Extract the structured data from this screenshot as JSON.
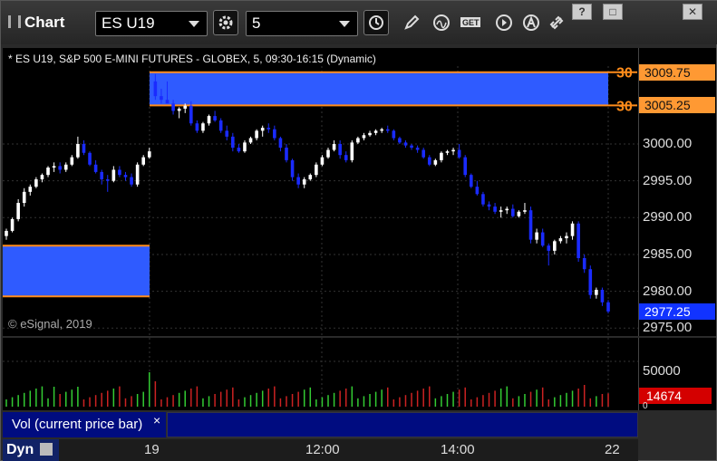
{
  "app": {
    "title": "Chart"
  },
  "toolbar": {
    "symbol": "ES U19",
    "interval": "5",
    "win_help": "?",
    "win_restore": "□",
    "win_close": "✕"
  },
  "chart": {
    "header": "* ES U19, S&P 500 E-MINI FUTURES - GLOBEX, 5, 09:30-16:15 (Dynamic)",
    "copyright": "© eSignal, 2019",
    "zone_label_1": "30",
    "zone_label_2": "30",
    "price_ticks": [
      "3000.00",
      "2995.00",
      "2990.00",
      "2985.00",
      "2980.00",
      "2975.00"
    ],
    "upper_zone_high": "3009.75",
    "upper_zone_low": "3005.25",
    "current_price": "2977.25",
    "colors": {
      "zone_fill": "#2f5bff",
      "zone_edge": "#ff8c1a",
      "up": "#ffffff",
      "down": "#1a2bff",
      "current": "#1133ff"
    }
  },
  "volume": {
    "label": "Vol (current price bar)",
    "close_glyph": "×",
    "tick": "50000",
    "current_value": "14674",
    "zero": "0"
  },
  "time_axis": {
    "labels": [
      "19",
      "12:00",
      "14:00",
      "22"
    ]
  },
  "footer": {
    "dyn_label": "Dyn"
  },
  "chart_data": {
    "type": "candlestick",
    "ylim": [
      2975,
      3011
    ],
    "candles": [
      [
        2987.5,
        2988.5,
        2987,
        2988.2
      ],
      [
        2988.2,
        2990,
        2988,
        2989.8
      ],
      [
        2989.8,
        2992.5,
        2989.5,
        2992
      ],
      [
        2992,
        2994,
        2991.5,
        2993.5
      ],
      [
        2993.5,
        2994.5,
        2993,
        2994.2
      ],
      [
        2994.2,
        2995.5,
        2994,
        2995.2
      ],
      [
        2995.2,
        2996,
        2994.8,
        2995.8
      ],
      [
        2995.8,
        2997,
        2995.5,
        2996.8
      ],
      [
        2996.8,
        2997.5,
        2996.2,
        2997
      ],
      [
        2997,
        2997.5,
        2996,
        2996.5
      ],
      [
        2996.5,
        2997.5,
        2996.2,
        2997.2
      ],
      [
        2997.2,
        2998.5,
        2997,
        2998.2
      ],
      [
        2998.2,
        3001,
        2998,
        3000
      ],
      [
        3000,
        3000.5,
        2998.5,
        2998.8
      ],
      [
        2998.8,
        2999,
        2997,
        2997.2
      ],
      [
        2997.2,
        2997.8,
        2996,
        2996.2
      ],
      [
        2996.2,
        2996.5,
        2994.5,
        2995.2
      ],
      [
        2995.2,
        2995.8,
        2993.5,
        2995
      ],
      [
        2995,
        2997,
        2994.8,
        2996.5
      ],
      [
        2996.5,
        2997,
        2995.5,
        2995.8
      ],
      [
        2995.8,
        2996.2,
        2995,
        2995.5
      ],
      [
        2995.5,
        2996,
        2994.2,
        2994.5
      ],
      [
        2994.5,
        2997.5,
        2994.2,
        2997.2
      ],
      [
        2997.2,
        2998.5,
        2997,
        2998.2
      ],
      [
        2998.2,
        2999.5,
        2998,
        2999
      ],
      [
        3008.5,
        3009.5,
        3006,
        3006.5
      ],
      [
        3006.5,
        3007.5,
        3005.5,
        3006
      ],
      [
        3006,
        3008.5,
        3005.8,
        3005.5
      ],
      [
        3005.5,
        3006,
        3004,
        3004.5
      ],
      [
        3004.5,
        3005,
        3003.5,
        3004.8
      ],
      [
        3004.8,
        3005.5,
        3004.2,
        3005.2
      ],
      [
        3005.2,
        3005.8,
        3002.5,
        3002.8
      ],
      [
        3002.8,
        3003.2,
        3001.5,
        3001.8
      ],
      [
        3001.8,
        3003,
        3001.5,
        3002.8
      ],
      [
        3002.8,
        3004,
        3002.5,
        3003.8
      ],
      [
        3003.8,
        3004.5,
        3003,
        3003.2
      ],
      [
        3003.2,
        3003.5,
        3001.5,
        3001.8
      ],
      [
        3001.8,
        3002.5,
        3000.5,
        3001
      ],
      [
        3001,
        3001.5,
        2999,
        2999.5
      ],
      [
        2999.5,
        3000,
        2998.8,
        2999
      ],
      [
        2999,
        3000.5,
        2998.8,
        3000.2
      ],
      [
        3000.2,
        3001,
        3000,
        3000.8
      ],
      [
        3000.8,
        3002,
        3000.5,
        3001.8
      ],
      [
        3001.8,
        3002.5,
        3001,
        3002.2
      ],
      [
        3002.2,
        3002.8,
        3001.5,
        3002
      ],
      [
        3002,
        3002.5,
        3000.5,
        3000.8
      ],
      [
        3000.8,
        3001,
        2999,
        2999.5
      ],
      [
        2999.5,
        3000,
        2997.5,
        2997.8
      ],
      [
        2997.8,
        2998,
        2995,
        2995.5
      ],
      [
        2995.5,
        2996,
        2994,
        2994.5
      ],
      [
        2994.5,
        2995.5,
        2994,
        2995.2
      ],
      [
        2995.2,
        2996,
        2995,
        2995.8
      ],
      [
        2995.8,
        2997.5,
        2995.5,
        2997.2
      ],
      [
        2997.2,
        2998.5,
        2997,
        2998.2
      ],
      [
        2998.2,
        2999.5,
        2998,
        2999.2
      ],
      [
        2999.2,
        3000.5,
        2999,
        3000
      ],
      [
        3000,
        3000.5,
        2998,
        2998.5
      ],
      [
        2998.5,
        2999,
        2997.5,
        2997.8
      ],
      [
        2997.8,
        3000.5,
        2997.5,
        3000.2
      ],
      [
        3000.2,
        3001,
        3000,
        3000.8
      ],
      [
        3000.8,
        3001.5,
        3000.5,
        3001.2
      ],
      [
        3001.2,
        3001.8,
        3001,
        3001.5
      ],
      [
        3001.5,
        3002,
        3001.2,
        3001.8
      ],
      [
        3001.8,
        3002.2,
        3001.5,
        3002
      ],
      [
        3002,
        3002.5,
        3001.5,
        3001.8
      ],
      [
        3001.8,
        3002,
        3000.5,
        3000.8
      ],
      [
        3000.8,
        3001,
        3000,
        3000.2
      ],
      [
        3000.2,
        3000.5,
        2999.5,
        2999.8
      ],
      [
        2999.8,
        3000,
        2999.2,
        2999.5
      ],
      [
        2999.5,
        2999.8,
        2998.8,
        2999.2
      ],
      [
        2999.2,
        2999.5,
        2998,
        2998.2
      ],
      [
        2998.2,
        2998.5,
        2997,
        2997.2
      ],
      [
        2997.2,
        2998,
        2997,
        2997.8
      ],
      [
        2997.8,
        2999,
        2997.5,
        2998.8
      ],
      [
        2998.8,
        2999.2,
        2998.5,
        2999
      ],
      [
        2999,
        2999.5,
        2998.5,
        2999.2
      ],
      [
        2999.2,
        3000,
        2998,
        2998.2
      ],
      [
        2998.2,
        2998.5,
        2995.5,
        2995.8
      ],
      [
        2995.8,
        2996,
        2994,
        2994.2
      ],
      [
        2994.2,
        2995,
        2993,
        2993.2
      ],
      [
        2993.2,
        2993.5,
        2991.5,
        2991.8
      ],
      [
        2991.8,
        2992.2,
        2991,
        2991.5
      ],
      [
        2991.5,
        2992,
        2990.5,
        2990.8
      ],
      [
        2990.8,
        2991.5,
        2990,
        2991
      ],
      [
        2991,
        2991.5,
        2990.5,
        2991.2
      ],
      [
        2991.2,
        2991.8,
        2990,
        2990.2
      ],
      [
        2990.2,
        2991,
        2990,
        2990.8
      ],
      [
        2990.8,
        2992,
        2990.5,
        2991
      ],
      [
        2991,
        2991.5,
        2986.5,
        2987
      ],
      [
        2987,
        2988.5,
        2986.5,
        2988
      ],
      [
        2988,
        2988.5,
        2986,
        2986.2
      ],
      [
        2986.2,
        2986.5,
        2983.5,
        2985.5
      ],
      [
        2985.5,
        2987,
        2985,
        2986.8
      ],
      [
        2986.8,
        2987.5,
        2986.5,
        2987.2
      ],
      [
        2987.2,
        2988,
        2986.5,
        2987.5
      ],
      [
        2987.5,
        2989.5,
        2987,
        2989.2
      ],
      [
        2989.2,
        2989.5,
        2984,
        2984.5
      ],
      [
        2984.5,
        2985,
        2982.5,
        2983
      ],
      [
        2983,
        2983.5,
        2979,
        2979.5
      ],
      [
        2979.5,
        2980.5,
        2979,
        2980.2
      ],
      [
        2980.2,
        2980.5,
        2978,
        2978.5
      ],
      [
        2978.5,
        2978.8,
        2977,
        2977.25
      ]
    ]
  }
}
